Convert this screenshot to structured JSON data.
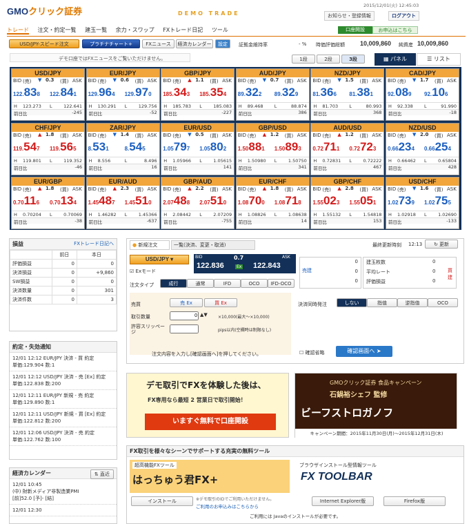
{
  "header": {
    "logo_main": "GMO",
    "logo_sub": "クリック証券",
    "demo": "DEMO TRADE",
    "datetime": "2015/12/01(火) 12:45:03",
    "link_inquiry": "お知らせ・登録情報",
    "link_logout": "ログアウト",
    "tab_account": "口座開設",
    "tab_guide": "お申込はこちら"
  },
  "nav": [
    "トレード",
    "注文・約定一覧",
    "建玉一覧",
    "余力・スワップ",
    "FXトレード日記",
    "ツール"
  ],
  "toolbar": {
    "speed": "USD/JPY-スピード注文",
    "platinum": "プラチナチャート+",
    "fxnews": "FXニュース",
    "calendar": "経済カレンダー",
    "settings": "設定",
    "margin_rate_label": "証拠金維持率",
    "margin_rate": "- %",
    "valuation_label": "時価評価総額",
    "valuation": "10,009,860",
    "assets_label": "純資産",
    "assets": "10,009,860"
  },
  "notice": "デモ口座ではFXニュースをご覧いただけません。",
  "lots": [
    "1段",
    "2段",
    "3段"
  ],
  "view": {
    "panel": "パネル",
    "list": "リスト"
  },
  "tiles": [
    {
      "pair": "USD/JPY",
      "arrow": "▼",
      "spread": "0.3",
      "bid_s": "122.",
      "bid_b": "83",
      "bid_e": "8",
      "ask_s": "122.",
      "ask_b": "84",
      "ask_e": "1",
      "h": "123.273",
      "l": "122.641",
      "chg": "-245",
      "bc": "blue",
      "ac": "blue"
    },
    {
      "pair": "EUR/JPY",
      "arrow": "▼",
      "spread": "0.6",
      "bid_s": "129.",
      "bid_b": "96",
      "bid_e": "4",
      "ask_s": "129.",
      "ask_b": "97",
      "ask_e": "0",
      "h": "130.291",
      "l": "129.756",
      "chg": "-52",
      "bc": "blue",
      "ac": "blue"
    },
    {
      "pair": "GBP/JPY",
      "arrow": "▲",
      "spread": "1.1",
      "bid_s": "185.",
      "bid_b": "34",
      "bid_e": "3",
      "ask_s": "185.",
      "ask_b": "35",
      "ask_e": "4",
      "h": "185.783",
      "l": "185.083",
      "chg": "-227",
      "bc": "red",
      "ac": "red"
    },
    {
      "pair": "AUD/JPY",
      "arrow": "▼",
      "spread": "0.7",
      "bid_s": "89.",
      "bid_b": "32",
      "bid_e": "2",
      "ask_s": "89.",
      "ask_b": "32",
      "ask_e": "9",
      "h": "89.468",
      "l": "88.874",
      "chg": "386",
      "bc": "blue",
      "ac": "blue"
    },
    {
      "pair": "NZD/JPY",
      "arrow": "▼",
      "spread": "1.5",
      "bid_s": "81.",
      "bid_b": "36",
      "bid_e": "6",
      "ask_s": "81.",
      "ask_b": "38",
      "ask_e": "1",
      "h": "81.703",
      "l": "80.993",
      "chg": "368",
      "bc": "blue",
      "ac": "blue"
    },
    {
      "pair": "CAD/JPY",
      "arrow": "▼",
      "spread": "1.7",
      "bid_s": "92.",
      "bid_b": "08",
      "bid_e": "9",
      "ask_s": "92.",
      "ask_b": "10",
      "ask_e": "6",
      "h": "92.338",
      "l": "91.990",
      "chg": "-18",
      "bc": "blue",
      "ac": "blue"
    },
    {
      "pair": "CHF/JPY",
      "arrow": "▲",
      "spread": "1.8",
      "bid_s": "119.",
      "bid_b": "54",
      "bid_e": "7",
      "ask_s": "119.",
      "ask_b": "56",
      "ask_e": "5",
      "h": "119.801",
      "l": "119.352",
      "chg": "-46",
      "bc": "red",
      "ac": "red"
    },
    {
      "pair": "ZAR/JPY",
      "arrow": "▼",
      "spread": "1.4",
      "bid_s": "8.",
      "bid_b": "53",
      "bid_e": "1",
      "ask_s": "8.",
      "ask_b": "54",
      "ask_e": "5",
      "h": "8.556",
      "l": "8.496",
      "chg": "16",
      "bc": "blue",
      "ac": "blue"
    },
    {
      "pair": "EUR/USD",
      "arrow": "▼",
      "spread": "0.5",
      "bid_s": "1.05",
      "bid_b": "79",
      "bid_e": "7",
      "ask_s": "1.05",
      "ask_b": "80",
      "ask_e": "2",
      "h": "1.05966",
      "l": "1.05615",
      "chg": "141",
      "bc": "blue",
      "ac": "blue"
    },
    {
      "pair": "GBP/USD",
      "arrow": "▲",
      "spread": "1.2",
      "bid_s": "1.50",
      "bid_b": "88",
      "bid_e": "1",
      "ask_s": "1.50",
      "ask_b": "89",
      "ask_e": "3",
      "h": "1.50980",
      "l": "1.50750",
      "chg": "341",
      "bc": "red",
      "ac": "red"
    },
    {
      "pair": "AUD/USD",
      "arrow": "▲",
      "spread": "1.2",
      "bid_s": "0.72",
      "bid_b": "71",
      "bid_e": "1",
      "ask_s": "0.72",
      "ask_b": "72",
      "ask_e": "3",
      "h": "0.72831",
      "l": "0.72222",
      "chg": "467",
      "bc": "red",
      "ac": "red"
    },
    {
      "pair": "NZD/USD",
      "arrow": "▼",
      "spread": "2.0",
      "bid_s": "0.66",
      "bid_b": "23",
      "bid_e": "4",
      "ask_s": "0.66",
      "ask_b": "25",
      "ask_e": "4",
      "h": "0.66462",
      "l": "0.65804",
      "chg": "428",
      "bc": "blue",
      "ac": "blue"
    },
    {
      "pair": "EUR/GBP",
      "arrow": "▲",
      "spread": "1.8",
      "bid_s": "0.70",
      "bid_b": "11",
      "bid_e": "6",
      "ask_s": "0.70",
      "ask_b": "13",
      "ask_e": "4",
      "h": "0.70204",
      "l": "0.70069",
      "chg": "-38",
      "bc": "red",
      "ac": "red"
    },
    {
      "pair": "EUR/AUD",
      "arrow": "▲",
      "spread": "2.3",
      "bid_s": "1.45",
      "bid_b": "48",
      "bid_e": "7",
      "ask_s": "1.45",
      "ask_b": "51",
      "ask_e": "0",
      "h": "1.46282",
      "l": "1.45366",
      "chg": "-637",
      "bc": "red",
      "ac": "red"
    },
    {
      "pair": "GBP/AUD",
      "arrow": "▲",
      "spread": "2.2",
      "bid_s": "2.07",
      "bid_b": "48",
      "bid_e": "8",
      "ask_s": "2.07",
      "ask_b": "51",
      "ask_e": "0",
      "h": "2.08442",
      "l": "2.07209",
      "chg": "-755",
      "bc": "red",
      "ac": "red"
    },
    {
      "pair": "EUR/CHF",
      "arrow": "▲",
      "spread": "1.8",
      "bid_s": "1.08",
      "bid_b": "70",
      "bid_e": "0",
      "ask_s": "1.08",
      "ask_b": "71",
      "ask_e": "8",
      "h": "1.08826",
      "l": "1.08638",
      "chg": "14",
      "bc": "red",
      "ac": "red"
    },
    {
      "pair": "GBP/CHF",
      "arrow": "▲",
      "spread": "2.8",
      "bid_s": "1.55",
      "bid_b": "02",
      "bid_e": "3",
      "ask_s": "1.55",
      "ask_b": "05",
      "ask_e": "1",
      "h": "1.55132",
      "l": "1.54818",
      "chg": "153",
      "bc": "red",
      "ac": "red"
    },
    {
      "pair": "USD/CHF",
      "arrow": "▼",
      "spread": "1.6",
      "bid_s": "1.02",
      "bid_b": "73",
      "bid_e": "9",
      "ask_s": "1.02",
      "ask_b": "75",
      "ask_e": "5",
      "h": "1.02918",
      "l": "1.02690",
      "chg": "-133",
      "bc": "blue",
      "ac": "blue"
    }
  ],
  "labels": {
    "bid": "BID",
    "sell": "(売)",
    "ask": "ASK",
    "buy": "(買)",
    "h": "H",
    "l": "L",
    "prev": "前日比"
  },
  "pl": {
    "title": "損益",
    "link": "FXトレード日記へ",
    "col_prev": "前日",
    "col_today": "本日",
    "rows": [
      {
        "k": "評価損益",
        "a": "0",
        "b": "0"
      },
      {
        "k": "決済損益",
        "a": "0",
        "b": "+9,860"
      },
      {
        "k": "SW損益",
        "a": "0",
        "b": "0"
      },
      {
        "k": "決済数量",
        "a": "0",
        "b": "301"
      },
      {
        "k": "決済件数",
        "a": "0",
        "b": "3"
      }
    ]
  },
  "exec": {
    "title": "約定・失効通知",
    "items": [
      {
        "l1": "12/01 12:12 EUR/JPY 決済 - 買 約定",
        "l2": "単価:129.904 数:1"
      },
      {
        "l1": "12/01 12:12 USD/JPY 決済 - 売 [Ex] 約定",
        "l2": "単価:122.838 数:200"
      },
      {
        "l1": "12/01 12:11 EUR/JPY 新規 - 売 約定",
        "l2": "単価:129.890 数:1"
      },
      {
        "l1": "12/01 12:11 USD/JPY 新規 - 買 [Ex] 約定",
        "l2": "単価:122.812 数:200"
      },
      {
        "l1": "12/01 12:06 USD/JPY 決済 - 売 約定",
        "l2": "単価:122.762 数:100"
      }
    ]
  },
  "cal": {
    "title": "経済カレンダー",
    "btn": "直近",
    "items": [
      {
        "l1": "12/01 10:45",
        "l2": "(中) 財新メディア非製造業PMI",
        "l3": "[前]52.0 [予]- [結]"
      },
      {
        "l1": "12/01 12:30",
        "l2": ""
      }
    ]
  },
  "order": {
    "tab_new": "新規注文",
    "tab_list": "一覧(決済、変更・取消)",
    "updated_label": "最終更新時刻",
    "updated": "12:13",
    "refresh": "更新",
    "pair": "USD/JPY",
    "spread": "0.7",
    "ex": "Ex",
    "bid": "122.836",
    "ask": "122.843",
    "exmode": "Exモード",
    "type_label": "注文タイプ",
    "types": [
      "成行",
      "通常",
      "IFD",
      "OCO",
      "IFD-OCO"
    ],
    "side_label": "売買",
    "sell": "売 Ex",
    "buy": "買 Ex",
    "qty_label": "取引数量",
    "qty": "0",
    "qty_note": "×10,000(最大～×10,000)",
    "slip_label": "許容スリッページ",
    "slip_note": "pips以内(空欄時は制限なし)",
    "settle_label": "決済同時発注",
    "settle": [
      "しない",
      "指值",
      "逆指值",
      "OCO"
    ],
    "confirm_msg": "注文内容を入力し[確認画面へ]を押してください。",
    "skip": "確認省略",
    "confirm": "確認画面へ",
    "sell_side": "売建",
    "buy_side": "買建",
    "pos_labels": [
      "建玉枚数",
      "平均レート",
      "評価損益"
    ],
    "pos_vals": [
      "0",
      "0",
      "0"
    ],
    "left_vals": [
      "0",
      "0",
      "0"
    ]
  },
  "ads": {
    "left_l1": "デモ取引でFXを体験した後は、",
    "left_l2": "FX専用なら最短 2 営業日で取引開始！",
    "left_btn": "いますぐ無料で口座開設",
    "right_l1": "GMOクリック証券 食品キャンペーン",
    "right_l2": "石鍋裕シェフ 監修",
    "right_l3": "ビーフストロガノフ",
    "right_l4": "キャンペーン期間：2015年11月30日(月)～2015年12月31日(木)",
    "tools_title": "FX取引を様々なシーンでサポートする充実の無料ツール",
    "tool1_tag": "超高機能FXツール",
    "tool1_name": "はっちゅう君FX+",
    "tool1_btn": "インストール",
    "tool1_note": "※デモ取引のIDでご利用いただけません。",
    "tool1_link": "ご利用のお申込みはこちらから",
    "java": "ご利用には Javaのインストールが必要です。",
    "tool2_tag": "ブラウザインストール型情報ツール",
    "tool2_name": "FX TOOLBAR",
    "tool2_ie": "Internet Explorer版",
    "tool2_ff": "Firefox版"
  }
}
